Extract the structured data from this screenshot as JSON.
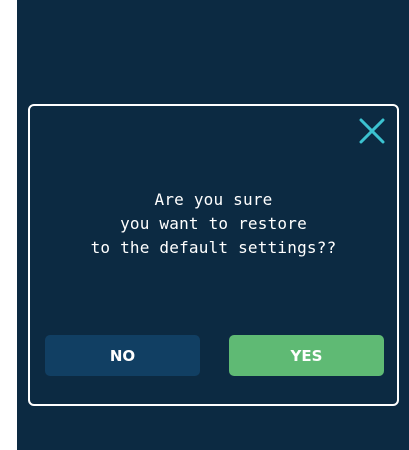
{
  "dialog": {
    "message_lines": [
      "Are you sure",
      "you want to restore",
      "to the default settings??"
    ],
    "close_icon": "close-icon",
    "no_label": "NO",
    "yes_label": "YES"
  },
  "colors": {
    "background": "#0c2a42",
    "dialog_border": "#ffffff",
    "close_icon": "#3cc2d0",
    "no_button": "#113f63",
    "yes_button": "#5fba74",
    "text": "#ffffff"
  }
}
